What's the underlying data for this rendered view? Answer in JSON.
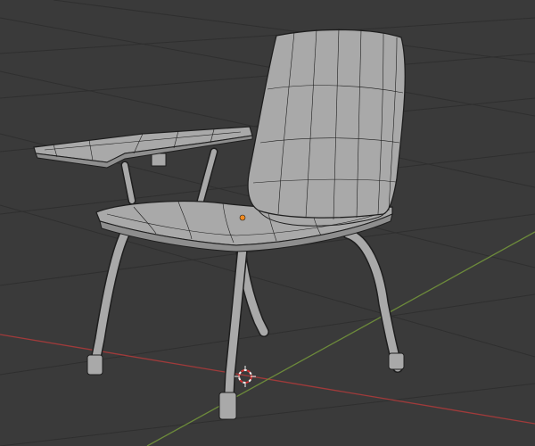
{
  "viewport": {
    "background": "#3a3a3a",
    "grid_color": "#2f2f2f",
    "x_axis_color": "#a03a3a",
    "y_axis_color": "#6c8a3a",
    "mode": "edit-wireframe"
  },
  "model": {
    "object": "student-chair-with-tablet-arm",
    "surface_color": "#a9a9a9",
    "surface_shade": "#8e8e8e",
    "edge_color": "#1e1e1e",
    "origin_color": "#f08a20"
  },
  "gizmos": {
    "cursor_3d": "3d-cursor-icon",
    "cursor_color": "#d23232"
  }
}
